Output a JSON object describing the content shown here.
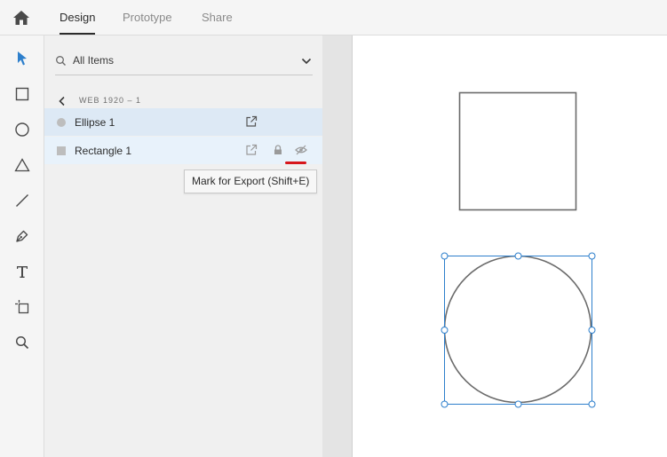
{
  "header": {
    "tabs": [
      {
        "label": "Design",
        "active": true
      },
      {
        "label": "Prototype",
        "active": false
      },
      {
        "label": "Share",
        "active": false
      }
    ]
  },
  "toolbar": {
    "tools": [
      "select-tool",
      "rectangle-tool",
      "ellipse-tool",
      "polygon-tool",
      "line-tool",
      "pen-tool",
      "text-tool",
      "artboard-tool",
      "zoom-tool"
    ],
    "active_tool": "select-tool"
  },
  "layers": {
    "filter_label": "All Items",
    "artboard_name": "WEB 1920 – 1",
    "items": [
      {
        "name": "Ellipse 1",
        "type": "ellipse",
        "selected": true
      },
      {
        "name": "Rectangle 1",
        "type": "rectangle",
        "selected": false,
        "hovered": true
      }
    ]
  },
  "tooltip": {
    "text": "Mark for Export (Shift+E)"
  },
  "colors": {
    "accent": "#2d7fcc",
    "selection_row": "#dde9f5",
    "hover_row": "#e8f2fb",
    "annotation_red": "#d7161b"
  }
}
